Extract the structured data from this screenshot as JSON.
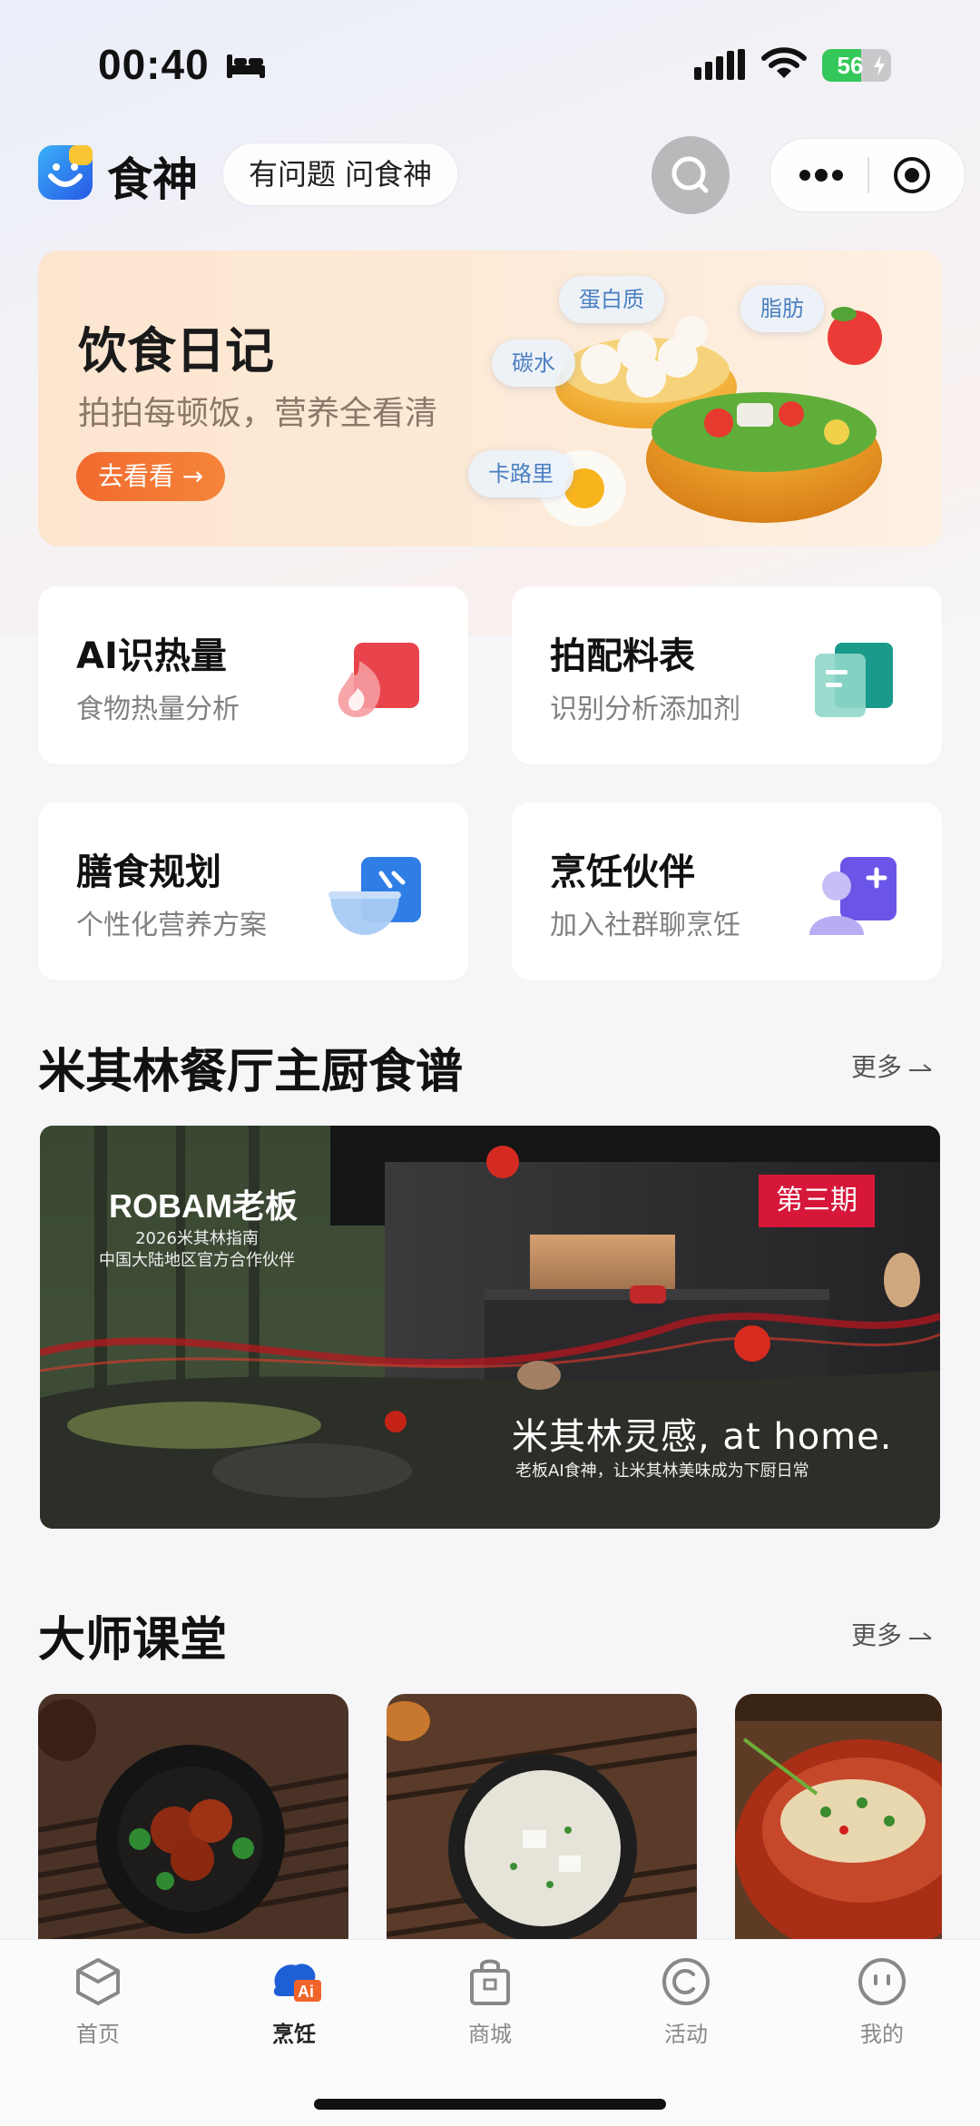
{
  "status_bar": {
    "time": "00:40",
    "battery": "56",
    "battery_level": 0.56
  },
  "header": {
    "app_title": "食神",
    "ask_label": "有问题 问食神"
  },
  "banner": {
    "title": "饮食日记",
    "subtitle": "拍拍每顿饭，营养全看清",
    "button": "去看看 →",
    "chips": [
      "蛋白质",
      "脂肪",
      "碳水",
      "卡路里"
    ]
  },
  "features": [
    {
      "title": "AI识热量",
      "subtitle": "食物热量分析",
      "icon": "flame-icon"
    },
    {
      "title": "拍配料表",
      "subtitle": "识别分析添加剂",
      "icon": "document-icon"
    },
    {
      "title": "膳食规划",
      "subtitle": "个性化营养方案",
      "icon": "bowl-icon"
    },
    {
      "title": "烹饪伙伴",
      "subtitle": "加入社群聊烹饪",
      "icon": "add-user-icon"
    }
  ],
  "michelin": {
    "title": "米其林餐厅主厨食谱",
    "more": "更多",
    "promo": {
      "brand": "ROBAM老板",
      "line1": "2026米其林指南",
      "line2": "中国大陆地区官方合作伙伴",
      "badge": "第三期",
      "headline": "米其林灵感, at home.",
      "tagline": "老板AI食神，让米其林美味成为下厨日常"
    }
  },
  "masterclass": {
    "title": "大师课堂",
    "more": "更多"
  },
  "tabbar": {
    "tabs": [
      {
        "label": "首页",
        "icon": "home-icon"
      },
      {
        "label": "烹饪",
        "icon": "cooking-ai-icon",
        "active": true
      },
      {
        "label": "商城",
        "icon": "shopping-bag-icon"
      },
      {
        "label": "活动",
        "icon": "activity-icon"
      },
      {
        "label": "我的",
        "icon": "profile-icon"
      }
    ]
  },
  "colors": {
    "accent_orange": "#f26a2e",
    "active_blue": "#1f6fe0",
    "badge_red": "#d6173a",
    "battery_green": "#34c759"
  }
}
